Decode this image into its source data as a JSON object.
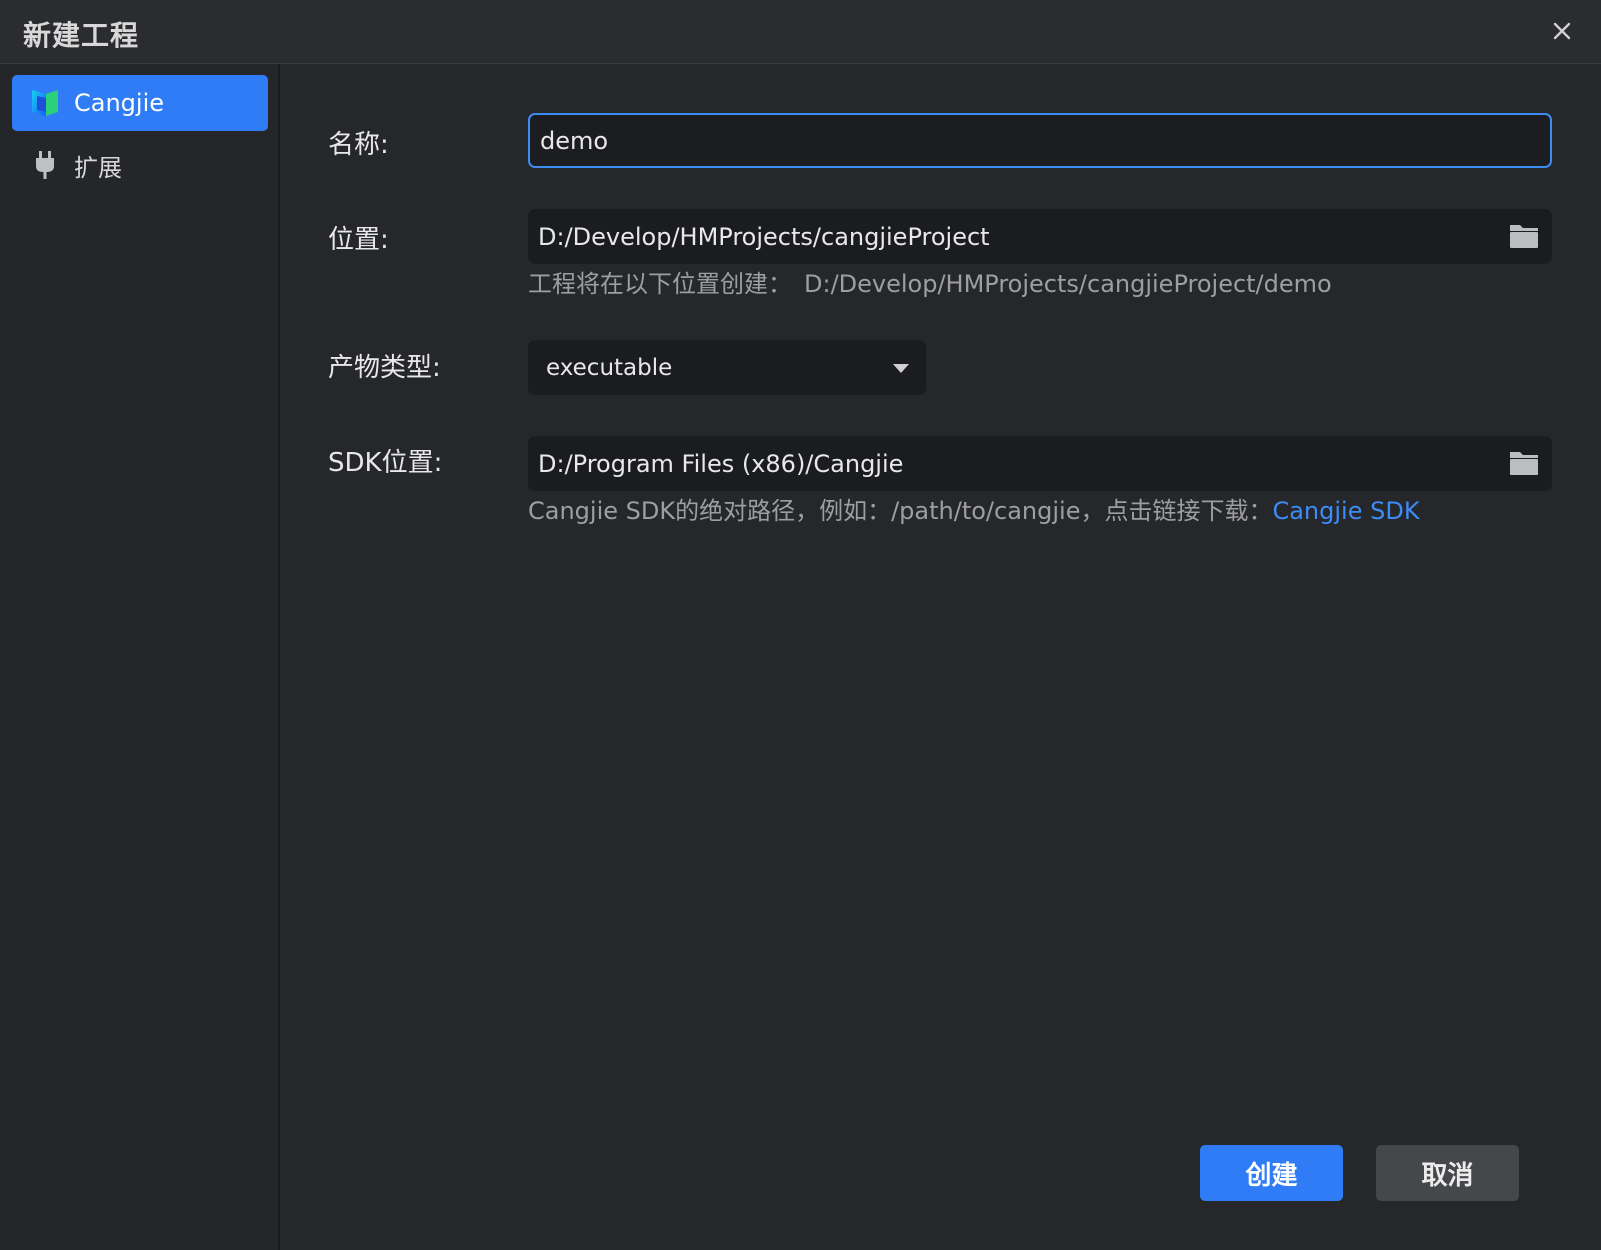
{
  "window": {
    "title": "新建工程"
  },
  "sidebar": {
    "items": [
      {
        "label": "Cangjie",
        "icon": "cangjie-logo-icon",
        "active": true
      },
      {
        "label": "扩展",
        "icon": "plug-icon",
        "active": false
      }
    ]
  },
  "form": {
    "name": {
      "label": "名称:",
      "value": "demo"
    },
    "location": {
      "label": "位置:",
      "value": "D:/Develop/HMProjects/cangjieProject",
      "hint_prefix": "工程将在以下位置创建：",
      "hint_path": "D:/Develop/HMProjects/cangjieProject/demo"
    },
    "artifact_type": {
      "label": "产物类型:",
      "value": "executable"
    },
    "sdk_location": {
      "label": "SDK位置:",
      "value": "D:/Program Files (x86)/Cangjie",
      "hint_text": "Cangjie SDK的绝对路径，例如：/path/to/cangjie，点击链接下载：",
      "hint_link": "Cangjie SDK"
    }
  },
  "footer": {
    "create_label": "创建",
    "cancel_label": "取消"
  },
  "colors": {
    "accent": "#2f7cf6",
    "link": "#3d8bf5",
    "background": "#26272b",
    "field_bg": "#1b1c1f"
  }
}
